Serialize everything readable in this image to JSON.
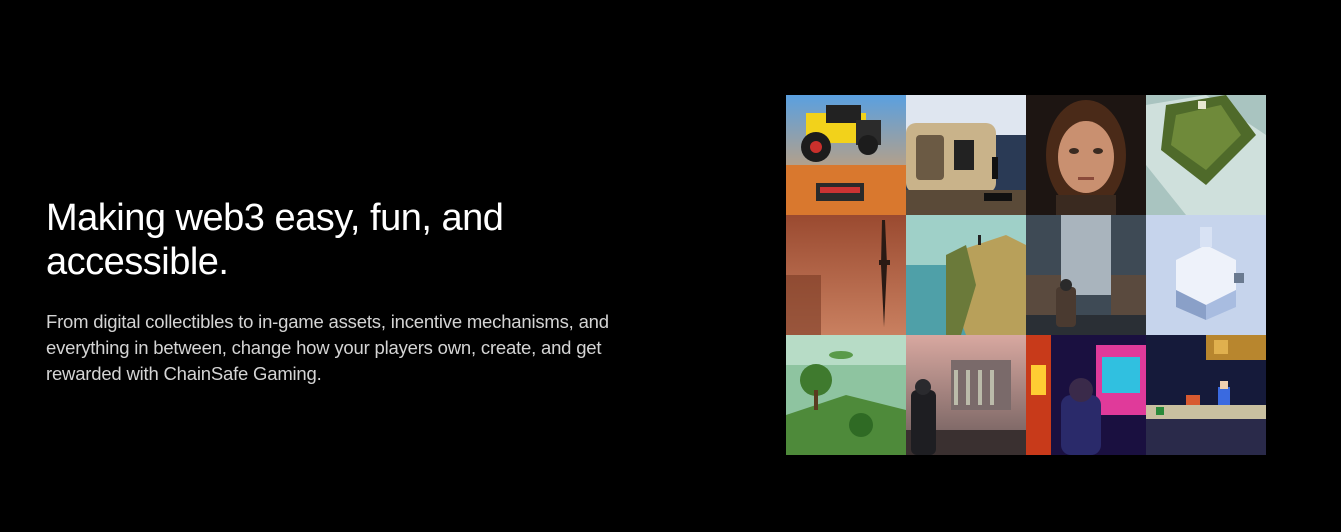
{
  "hero": {
    "headline": "Making web3 easy, fun, and accessible.",
    "description": "From digital collectibles to in-game assets, incentive mechanisms, and everything in between, change how your players own, create, and get rewarded with ChainSafe Gaming."
  },
  "gallery": {
    "tiles": [
      {
        "name": "tractor-voxel-image"
      },
      {
        "name": "sci-fi-station-image"
      },
      {
        "name": "girl-portrait-image"
      },
      {
        "name": "green-diorama-image"
      },
      {
        "name": "sword-desert-image"
      },
      {
        "name": "cliff-landscape-image"
      },
      {
        "name": "tunnel-soldier-image"
      },
      {
        "name": "snow-house-image"
      },
      {
        "name": "trees-island-image"
      },
      {
        "name": "ruined-city-image"
      },
      {
        "name": "arcade-neon-image"
      },
      {
        "name": "pixel-platformer-image"
      }
    ]
  },
  "colors": {
    "background": "#000000",
    "headline": "#ffffff",
    "body": "#d4d4d4"
  }
}
